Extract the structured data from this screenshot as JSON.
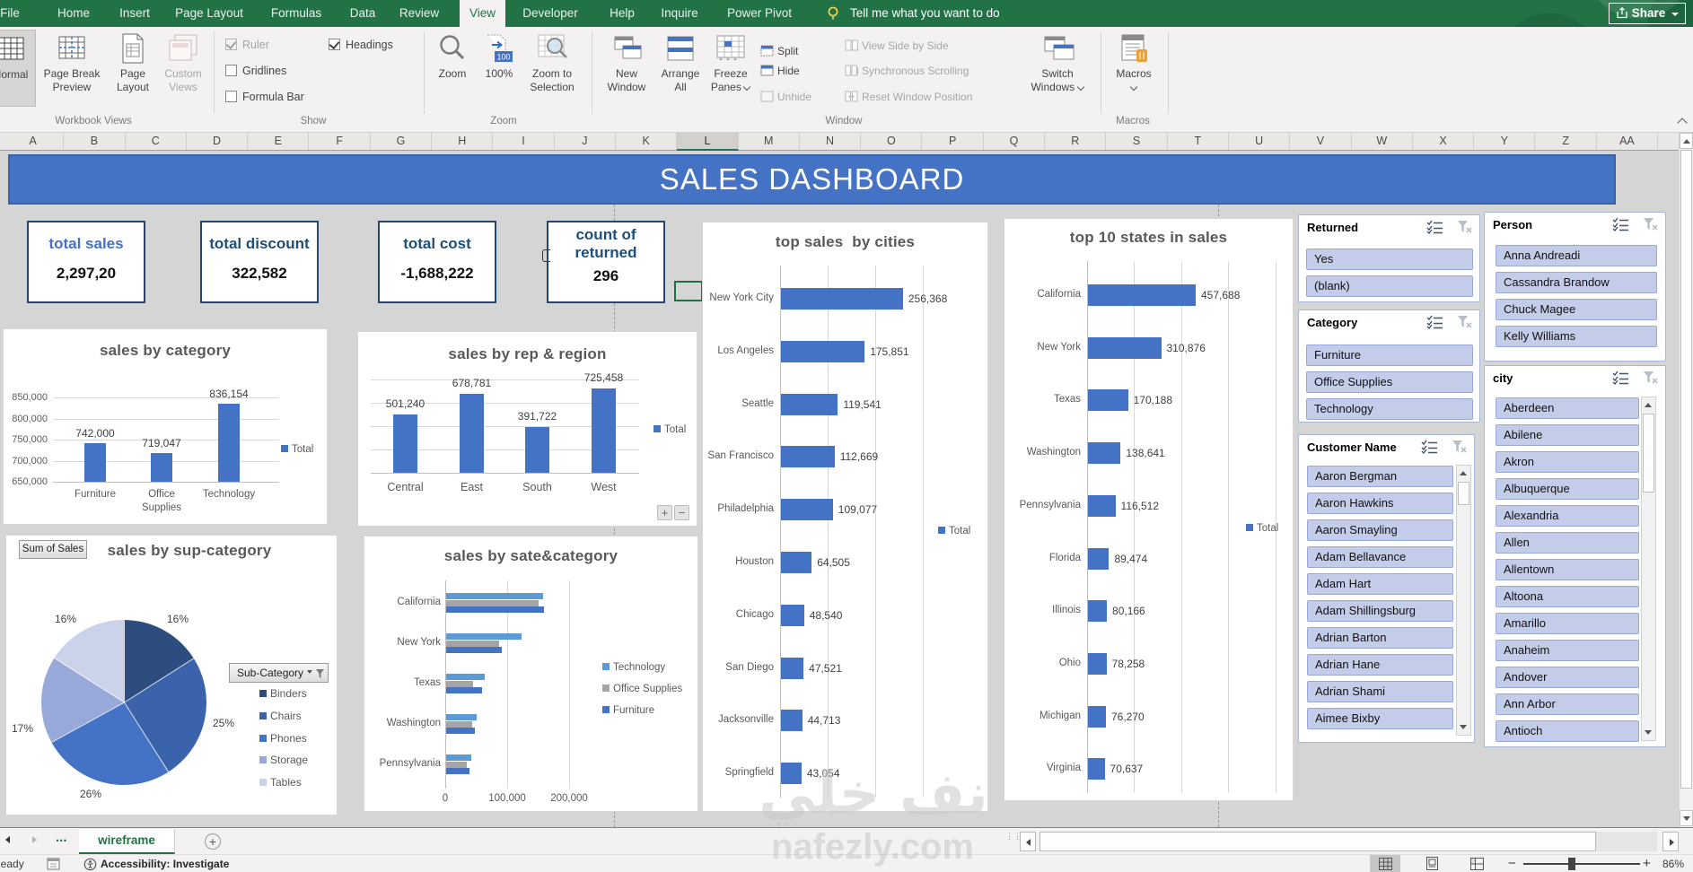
{
  "menu": {
    "tabs": [
      "File",
      "Home",
      "Insert",
      "Page Layout",
      "Formulas",
      "Data",
      "Review",
      "View",
      "Developer",
      "Help",
      "Inquire",
      "Power Pivot"
    ],
    "active_tab": "View",
    "tell_me": "Tell me what you want to do",
    "share_label": "Share"
  },
  "ribbon": {
    "workbook_views": {
      "label": "Workbook Views",
      "normal": "Normal",
      "page_break_1": "Page Break",
      "page_break_2": "Preview",
      "page_layout_1": "Page",
      "page_layout_2": "Layout",
      "custom_1": "Custom",
      "custom_2": "Views"
    },
    "show": {
      "label": "Show",
      "ruler": "Ruler",
      "gridlines": "Gridlines",
      "formula_bar": "Formula Bar",
      "headings": "Headings"
    },
    "zoom": {
      "label": "Zoom",
      "zoom": "Zoom",
      "hundred": "100%",
      "zts_1": "Zoom to",
      "zts_2": "Selection"
    },
    "window": {
      "label": "Window",
      "new_1": "New",
      "new_2": "Window",
      "arrange_1": "Arrange",
      "arrange_2": "All",
      "freeze_1": "Freeze",
      "freeze_2": "Panes",
      "split": "Split",
      "hide": "Hide",
      "unhide": "Unhide",
      "side_by_side": "View Side by Side",
      "sync_scroll": "Synchronous Scrolling",
      "reset_pos": "Reset Window Position",
      "switch_1": "Switch",
      "switch_2": "Windows"
    },
    "macros": {
      "label": "Macros",
      "macros": "Macros"
    }
  },
  "columns": [
    "A",
    "B",
    "C",
    "D",
    "E",
    "F",
    "G",
    "H",
    "I",
    "J",
    "K",
    "L",
    "M",
    "N",
    "O",
    "P",
    "Q",
    "R",
    "S",
    "T",
    "U",
    "V",
    "W",
    "X",
    "Y",
    "Z",
    "AA"
  ],
  "selected_column": "L",
  "dashboard": {
    "title": "SALES DASHBOARD",
    "kpis": [
      {
        "label": "total sales",
        "value": "2,297,20"
      },
      {
        "label": "total discount",
        "value": "322,582"
      },
      {
        "label": "total cost",
        "value": "-1,688,222"
      },
      {
        "label_1": "count of",
        "label_2": "returned",
        "value": "296"
      }
    ]
  },
  "chart_data": [
    {
      "id": "sales_by_category",
      "type": "bar",
      "title": "sales by category",
      "categories": [
        "Furniture",
        "Office Supplies",
        "Technology"
      ],
      "values": [
        742000,
        719047,
        836154
      ],
      "value_labels": [
        "742,000",
        "719,047",
        "836,154"
      ],
      "ylim": [
        650000,
        850000
      ],
      "yticks": [
        {
          "v": 850000,
          "t": "850,000"
        },
        {
          "v": 800000,
          "t": "800,000"
        },
        {
          "v": 750000,
          "t": "750,000"
        },
        {
          "v": 700000,
          "t": "700,000"
        },
        {
          "v": 650000,
          "t": "650,000"
        }
      ],
      "legend": "Total",
      "grid": true,
      "legend_position": "right"
    },
    {
      "id": "sales_by_rep_region",
      "type": "bar",
      "title": "sales by rep & region",
      "categories": [
        "Central",
        "East",
        "South",
        "West"
      ],
      "values": [
        501240,
        678781,
        391722,
        725458
      ],
      "value_labels": [
        "501,240",
        "678,781",
        "391,722",
        "725,458"
      ],
      "ylim": [
        0,
        800000
      ],
      "legend": "Total",
      "grid": true,
      "legend_position": "right",
      "plus_minus_buttons": [
        "+",
        "−"
      ]
    },
    {
      "id": "sales_by_sub_category",
      "type": "pie",
      "title": "sales by sup-category",
      "field_button": "Sum of Sales",
      "filter_button": "Sub-Category",
      "categories": [
        "Binders",
        "Chairs",
        "Phones",
        "Storage",
        "Tables"
      ],
      "values": [
        16,
        25,
        26,
        17,
        16
      ],
      "value_labels": [
        "16%",
        "25%",
        "26%",
        "17%",
        "16%"
      ],
      "colors": [
        "#2c4d7e",
        "#3a63ac",
        "#4472c4",
        "#97a8d9",
        "#cbd3eb"
      ],
      "legend_position": "right"
    },
    {
      "id": "sales_by_state_category",
      "type": "hbar-grouped",
      "title": "sales by sate&category",
      "categories": [
        "California",
        "New York",
        "Texas",
        "Washington",
        "Pennsylvania"
      ],
      "series": [
        {
          "name": "Technology",
          "color": "#5b9bd5",
          "values": [
            157000,
            122000,
            62000,
            49000,
            40000
          ]
        },
        {
          "name": "Office Supplies",
          "color": "#a5a5a5",
          "values": [
            149000,
            86000,
            43000,
            42000,
            33000
          ]
        },
        {
          "name": "Furniture",
          "color": "#4472c4",
          "values": [
            158000,
            90000,
            58000,
            46000,
            38000
          ]
        }
      ],
      "xticks": [
        {
          "v": 0,
          "t": "0"
        },
        {
          "v": 100000,
          "t": "100,000"
        },
        {
          "v": 200000,
          "t": "200,000"
        }
      ],
      "xlim": [
        0,
        250000
      ],
      "grid": true,
      "legend_position": "right"
    },
    {
      "id": "top_sales_by_cities",
      "type": "hbar",
      "title": "top sales  by cities",
      "categories": [
        "New York City",
        "Los Angeles",
        "Seattle",
        "San Francisco",
        "Philadelphia",
        "Houston",
        "Chicago",
        "San Diego",
        "Jacksonville",
        "Springfield"
      ],
      "values": [
        256368,
        175851,
        119541,
        112669,
        109077,
        64505,
        48540,
        47521,
        44713,
        43054
      ],
      "value_labels": [
        "256,368",
        "175,851",
        "119,541",
        "112,669",
        "109,077",
        "64,505",
        "48,540",
        "47,521",
        "44,713",
        "43,054"
      ],
      "xlim": [
        0,
        300000
      ],
      "gridstep": 100000,
      "legend": "Total",
      "grid": true,
      "legend_position": "right"
    },
    {
      "id": "top_10_states",
      "type": "hbar",
      "title": "top 10 states in sales",
      "categories": [
        "California",
        "New York",
        "Texas",
        "Washington",
        "Pennsylvania",
        "Florida",
        "Illinois",
        "Ohio",
        "Michigan",
        "Virginia"
      ],
      "values": [
        457688,
        310876,
        170188,
        138641,
        116512,
        89474,
        80166,
        78258,
        76270,
        70637
      ],
      "value_labels": [
        "457,688",
        "310,876",
        "170,188",
        "138,641",
        "116,512",
        "89,474",
        "80,166",
        "78,258",
        "76,270",
        "70,637"
      ],
      "xlim": [
        0,
        800000
      ],
      "gridstep": 200000,
      "legend": "Total",
      "grid": true,
      "legend_position": "right"
    }
  ],
  "slicers": [
    {
      "id": "returned",
      "title": "Returned",
      "items": [
        "Yes",
        "(blank)"
      ],
      "scrollbar": false
    },
    {
      "id": "category",
      "title": "Category",
      "items": [
        "Furniture",
        "Office Supplies",
        "Technology"
      ],
      "scrollbar": false
    },
    {
      "id": "customer",
      "title": "Customer Name",
      "items": [
        "Aaron Bergman",
        "Aaron Hawkins",
        "Aaron Smayling",
        "Adam Bellavance",
        "Adam Hart",
        "Adam Shillingsburg",
        "Adrian Barton",
        "Adrian Hane",
        "Adrian Shami",
        "Aimee Bixby"
      ],
      "scrollbar": true
    },
    {
      "id": "person",
      "title": "Person",
      "items": [
        "Anna Andreadi",
        "Cassandra Brandow",
        "Chuck Magee",
        "Kelly Williams"
      ],
      "scrollbar": false
    },
    {
      "id": "city",
      "title": "city",
      "items": [
        "Aberdeen",
        "Abilene",
        "Akron",
        "Albuquerque",
        "Alexandria",
        "Allen",
        "Allentown",
        "Altoona",
        "Amarillo",
        "Anaheim",
        "Andover",
        "Ann Arbor",
        "Antioch"
      ],
      "scrollbar": true
    }
  ],
  "sheet_tabs": {
    "ellipsis": "...",
    "active": "wireframe",
    "add": "+"
  },
  "status_bar": {
    "ready": "Ready",
    "accessibility": "Accessibility: Investigate",
    "zoom_level": "86%"
  },
  "watermark": {
    "line1": "نف خلي",
    "line2": "nafezly.com"
  }
}
